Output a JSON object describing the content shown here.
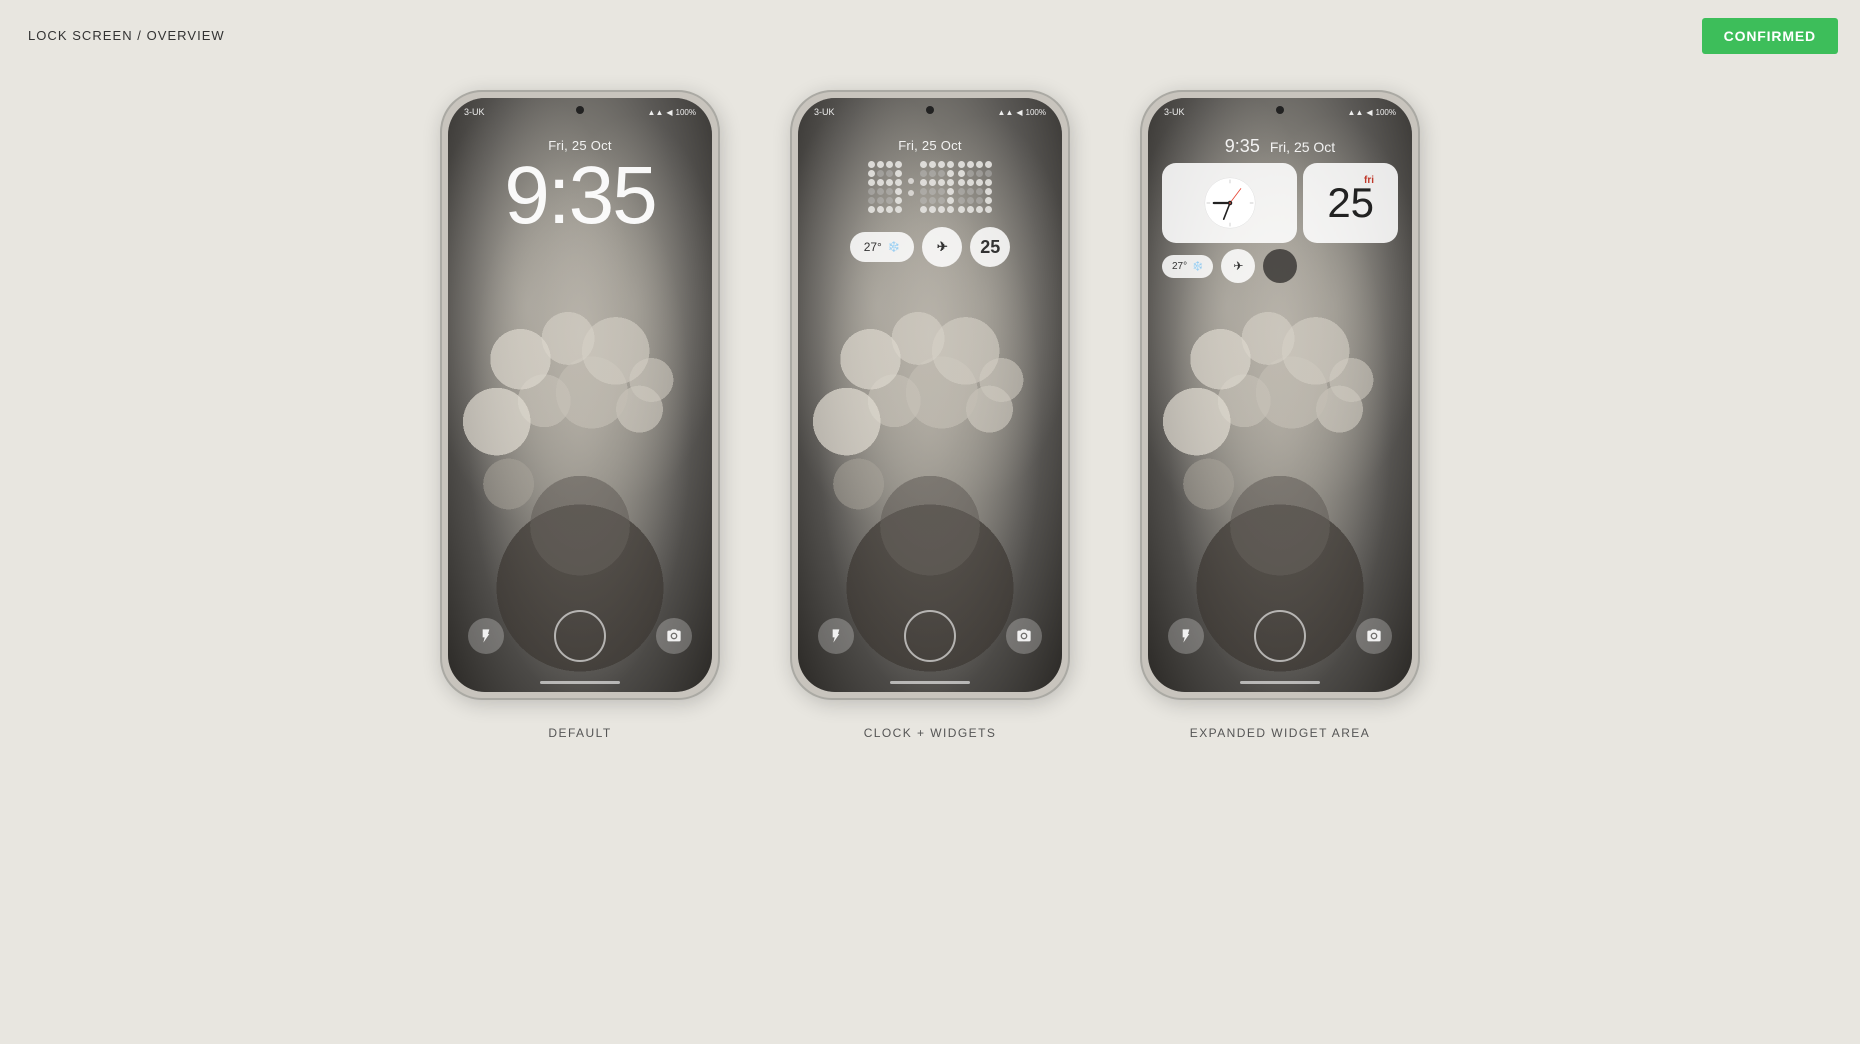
{
  "page": {
    "title": "LOCK SCREEN / OVERVIEW",
    "confirmed_label": "CONFIRMED",
    "confirmed_color": "#3dbe5a"
  },
  "phones": [
    {
      "id": "default",
      "label": "DEFAULT",
      "carrier": "3-UK",
      "battery": "100%",
      "date": "Fri, 25 Oct",
      "time": "9:35",
      "type": "default"
    },
    {
      "id": "clock-widgets",
      "label": "CLOCK + WIDGETS",
      "carrier": "3-UK",
      "battery": "100%",
      "date": "Fri, 25 Oct",
      "type": "dot-clock",
      "widget_temp": "27°",
      "widget_date_num": "25"
    },
    {
      "id": "expanded",
      "label": "EXPANDED WIDGET AREA",
      "carrier": "3-UK",
      "battery": "100%",
      "time_small": "9:35",
      "date_small": "Fri, 25 Oct",
      "cal_day": "fri",
      "cal_date": "25",
      "widget_temp": "27°",
      "type": "expanded"
    }
  ]
}
